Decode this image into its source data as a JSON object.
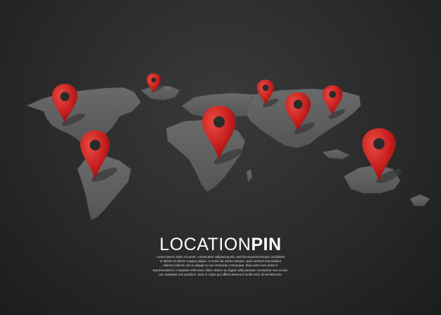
{
  "headline": {
    "light": "LOCATION",
    "bold": "PIN"
  },
  "body_lines": [
    "Lorem ipsum dolor sit amet, consectetur adipiscing elit, sed do eiusmod tempor incididunt",
    "ut labore et dolore magna aliqua. Ut enim ad minim veniam, quis nostrud exercitation",
    "ullamco laboris nisi ut aliquip ex ea commodo consequat. Duis aute irure dolor in",
    "reprehenderit in voluptate velit esse cillum dolore eu fugiat nulla pariatur. Excepteur sint occae-",
    "cat cupidatat non proident, sunt in culpa qui officia deserunt mollit anim id est laborum."
  ],
  "colors": {
    "pin": "#c8201f",
    "pin_dark": "#8e1212",
    "continent": "#5e5e5e",
    "shadow": "#3d3d3d"
  },
  "pins": [
    {
      "name": "north-america"
    },
    {
      "name": "greenland"
    },
    {
      "name": "south-america"
    },
    {
      "name": "europe"
    },
    {
      "name": "africa"
    },
    {
      "name": "middle-asia"
    },
    {
      "name": "east-asia"
    },
    {
      "name": "australia"
    }
  ]
}
